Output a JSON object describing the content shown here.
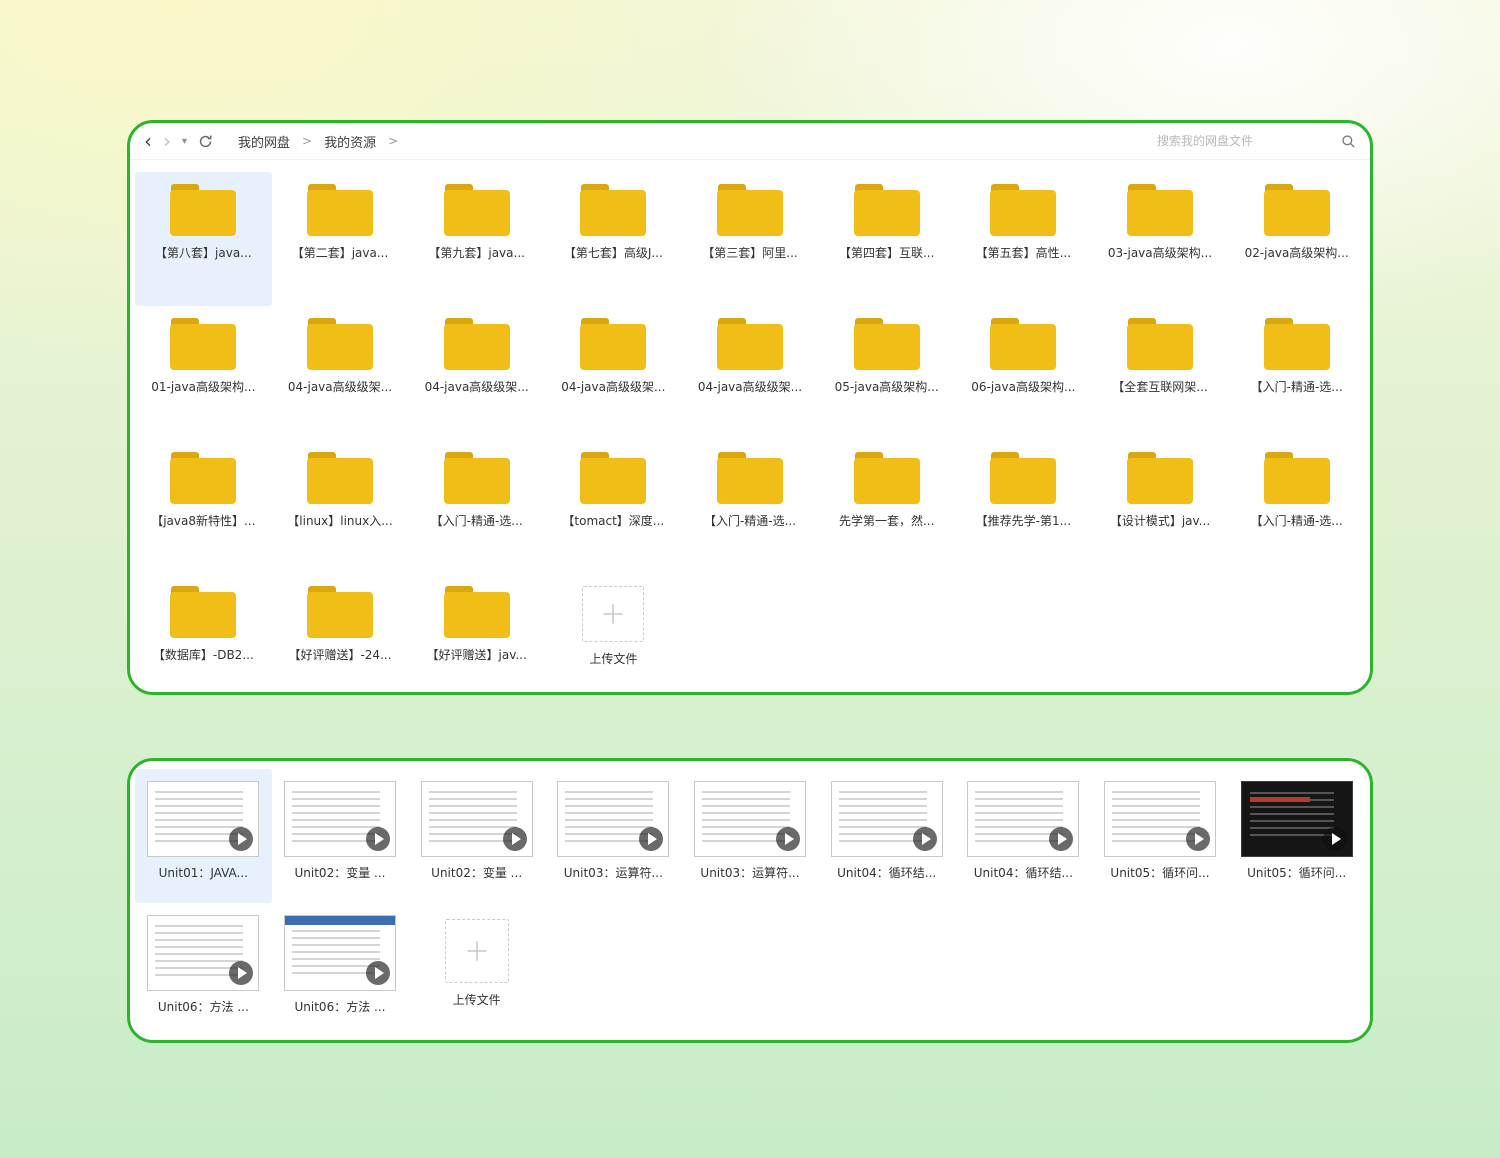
{
  "nav": {
    "breadcrumb": {
      "items": [
        "我的网盘",
        "我的资源"
      ],
      "separator": ">"
    },
    "search_placeholder": "搜索我的网盘文件",
    "icons": {
      "back": "‹",
      "forward": "›",
      "dropdown": "▾",
      "refresh": "circular-arrow",
      "search": "magnifier",
      "upload": "plus",
      "play": "triangle-in-circle"
    }
  },
  "colors": {
    "border_green": "#2bb52b",
    "selection_bg": "#e7f1fd",
    "folder_body": "#f1bd17",
    "folder_tab": "#dba70f",
    "thumb_dark_bg": "#151515",
    "thumb_blue_bar": "#3e6db2"
  },
  "panels": {
    "files": {
      "upload_label": "上传文件",
      "items": [
        {
          "name": "【第八套】java...",
          "selected": true
        },
        {
          "name": "【第二套】java..."
        },
        {
          "name": "【第九套】java..."
        },
        {
          "name": "【第七套】高级J..."
        },
        {
          "name": "【第三套】阿里..."
        },
        {
          "name": "【第四套】互联..."
        },
        {
          "name": "【第五套】高性..."
        },
        {
          "name": "03-java高级架构..."
        },
        {
          "name": "02-java高级架构..."
        },
        {
          "name": "01-java高级架构..."
        },
        {
          "name": "04-java高级级架..."
        },
        {
          "name": "04-java高级级架..."
        },
        {
          "name": "04-java高级级架..."
        },
        {
          "name": "04-java高级级架..."
        },
        {
          "name": "05-java高级架构..."
        },
        {
          "name": "06-java高级架构..."
        },
        {
          "name": "【全套互联网架..."
        },
        {
          "name": "【入门-精通-选..."
        },
        {
          "name": "【java8新特性】..."
        },
        {
          "name": "【linux】linux入..."
        },
        {
          "name": "【入门-精通-选..."
        },
        {
          "name": "【tomact】深度..."
        },
        {
          "name": "【入门-精通-选..."
        },
        {
          "name": "先学第一套，然..."
        },
        {
          "name": "【推荐先学-第1..."
        },
        {
          "name": "【设计模式】jav..."
        },
        {
          "name": "【入门-精通-选..."
        },
        {
          "name": "【数据库】-DB2..."
        },
        {
          "name": "【好评赠送】-24..."
        },
        {
          "name": "【好评赠送】jav..."
        }
      ]
    },
    "videos": {
      "upload_label": "上传文件",
      "items": [
        {
          "name": "Unit01：JAVA...",
          "variant": "light",
          "selected": true
        },
        {
          "name": "Unit02：变量 ...",
          "variant": "light"
        },
        {
          "name": "Unit02：变量 ...",
          "variant": "light"
        },
        {
          "name": "Unit03：运算符...",
          "variant": "light"
        },
        {
          "name": "Unit03：运算符...",
          "variant": "light"
        },
        {
          "name": "Unit04：循环结...",
          "variant": "light"
        },
        {
          "name": "Unit04：循环结...",
          "variant": "light"
        },
        {
          "name": "Unit05：循环问...",
          "variant": "light"
        },
        {
          "name": "Unit05：循环问...",
          "variant": "dark"
        },
        {
          "name": "Unit06：方法 ...",
          "variant": "light"
        },
        {
          "name": "Unit06：方法 ...",
          "variant": "blue"
        }
      ]
    }
  }
}
